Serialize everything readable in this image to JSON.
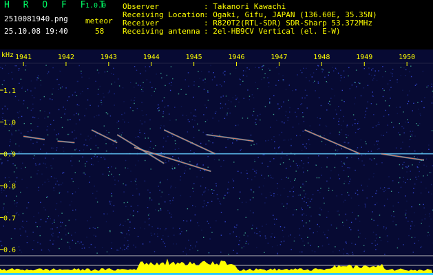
{
  "header": {
    "brand": "H R O F F T",
    "version": "1.0.0",
    "filename": "2510081940.png",
    "datetime": "25.10.08 19:40",
    "meteor_label": "meteor",
    "meteor_count": "58",
    "info": [
      {
        "key": "Observer",
        "value": ": Takanori Kawachi"
      },
      {
        "key": "Receiving Location",
        "value": ": Ogaki, Gifu, JAPAN (136.60E, 35.35N)"
      },
      {
        "key": "Receiver",
        "value": ": R820T2(RTL-SDR) SDR-Sharp 53.372MHz"
      },
      {
        "key": "Receiving antenna",
        "value": ": 2el-HB9CV Vertical (el. E-W)"
      }
    ]
  },
  "chart_data": {
    "type": "heatmap",
    "ylabel": "kHz",
    "x_ticks": [
      "1941",
      "1942",
      "1943",
      "1944",
      "1945",
      "1946",
      "1947",
      "1948",
      "1949",
      "1950"
    ],
    "y_ticks": [
      "1.1",
      "1.0",
      "0.9",
      "0.8",
      "0.7",
      "0.6"
    ],
    "ylim": [
      0.58,
      1.18
    ],
    "reference_line_khz": 0.9,
    "meteor_traces": [
      {
        "x": [
          1941.0,
          1941.5
        ],
        "y": [
          0.955,
          0.945
        ]
      },
      {
        "x": [
          1941.8,
          1942.2
        ],
        "y": [
          0.94,
          0.935
        ]
      },
      {
        "x": [
          1942.6,
          1943.2
        ],
        "y": [
          0.975,
          0.935
        ]
      },
      {
        "x": [
          1943.2,
          1944.3
        ],
        "y": [
          0.96,
          0.87
        ]
      },
      {
        "x": [
          1943.6,
          1945.4
        ],
        "y": [
          0.92,
          0.845
        ]
      },
      {
        "x": [
          1944.3,
          1945.5
        ],
        "y": [
          0.975,
          0.9
        ]
      },
      {
        "x": [
          1945.3,
          1946.4
        ],
        "y": [
          0.96,
          0.94
        ]
      },
      {
        "x": [
          1947.6,
          1948.9
        ],
        "y": [
          0.975,
          0.9
        ]
      },
      {
        "x": [
          1949.4,
          1950.4
        ],
        "y": [
          0.9,
          0.88
        ]
      }
    ],
    "colors": {
      "background": "#070a33",
      "trace": "#ff7755",
      "reference": "#66ccff",
      "power": "#ffff00",
      "ticks": "#ffff00"
    }
  }
}
